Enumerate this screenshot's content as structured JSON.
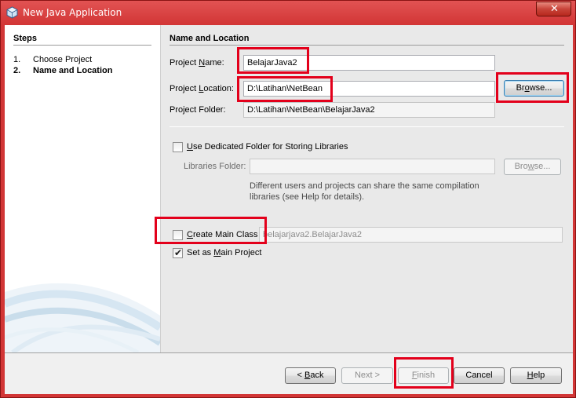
{
  "window": {
    "title": "New Java Application",
    "close_glyph": "✕"
  },
  "steps": {
    "title": "Steps",
    "items": [
      {
        "num": "1.",
        "label": "Choose Project"
      },
      {
        "num": "2.",
        "label": "Name and Location"
      }
    ]
  },
  "main": {
    "section_title": "Name and Location",
    "project_name": {
      "label_pre": "Project ",
      "label_u": "N",
      "label_post": "ame:",
      "value": "BelajarJava2"
    },
    "project_location": {
      "label_pre": "Project ",
      "label_u": "L",
      "label_post": "ocation:",
      "value": "D:\\Latihan\\NetBean"
    },
    "browse_label": {
      "pre": "Br",
      "u": "o",
      "post": "wse..."
    },
    "project_folder": {
      "label": "Project Folder:",
      "value": "D:\\Latihan\\NetBean\\BelajarJava2"
    },
    "dedicated_folder": {
      "label_u": "U",
      "label_post": "se Dedicated Folder for Storing Libraries",
      "checked": false
    },
    "libraries_folder": {
      "label": "Libraries Folder:",
      "value": ""
    },
    "browse2_label": {
      "pre": "Bro",
      "u": "w",
      "post": "se..."
    },
    "hint_text": "Different users and projects can share the same compilation libraries (see Help for details).",
    "create_main_class": {
      "label_u": "C",
      "label_post": "reate Main Class",
      "value": "belajarjava2.BelajarJava2",
      "checked": false
    },
    "set_main_project": {
      "label_pre": "Set as ",
      "label_u": "M",
      "label_post": "ain Project",
      "checked": true
    }
  },
  "buttons": {
    "back": {
      "pre": "< ",
      "u": "B",
      "post": "ack"
    },
    "next": "Next >",
    "finish": {
      "u": "F",
      "post": "inish"
    },
    "cancel": "Cancel",
    "help": {
      "u": "H",
      "post": "elp"
    }
  },
  "colors": {
    "highlight": "#e3001b",
    "frame": "#d23636"
  },
  "icons": {
    "app": "netbeans-cube-icon",
    "close": "close-icon",
    "check": "checkmark-icon"
  }
}
